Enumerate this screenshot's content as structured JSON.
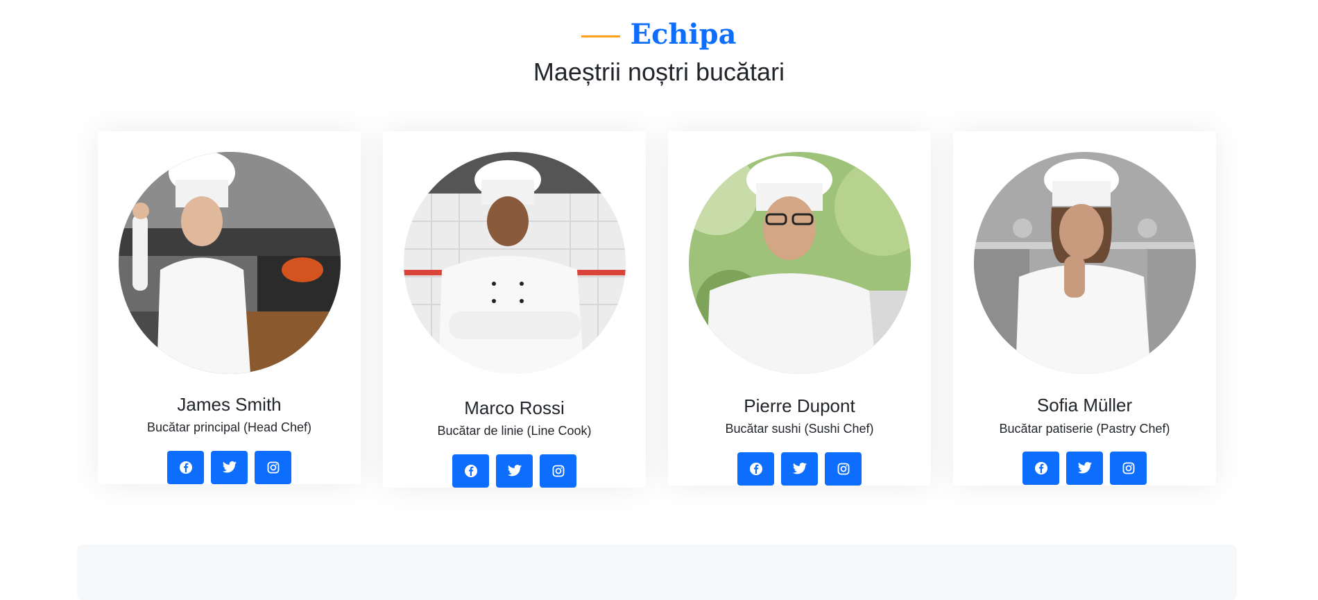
{
  "section": {
    "eyebrow": "Echipa",
    "subtitle": "Maeștrii noștri bucătari"
  },
  "team": [
    {
      "name": "James Smith",
      "role": "Bucătar principal (Head Chef)"
    },
    {
      "name": "Marco Rossi",
      "role": "Bucătar de linie (Line Cook)"
    },
    {
      "name": "Pierre Dupont",
      "role": "Bucătar sushi (Sushi Chef)"
    },
    {
      "name": "Sofia Müller",
      "role": "Bucătar patiserie (Pastry Chef)"
    }
  ],
  "icons": [
    "facebook-icon",
    "twitter-icon",
    "instagram-icon"
  ],
  "colors": {
    "accent": "#0D6EFD",
    "eyebrow_line": "#FEA116",
    "text": "#212529"
  }
}
